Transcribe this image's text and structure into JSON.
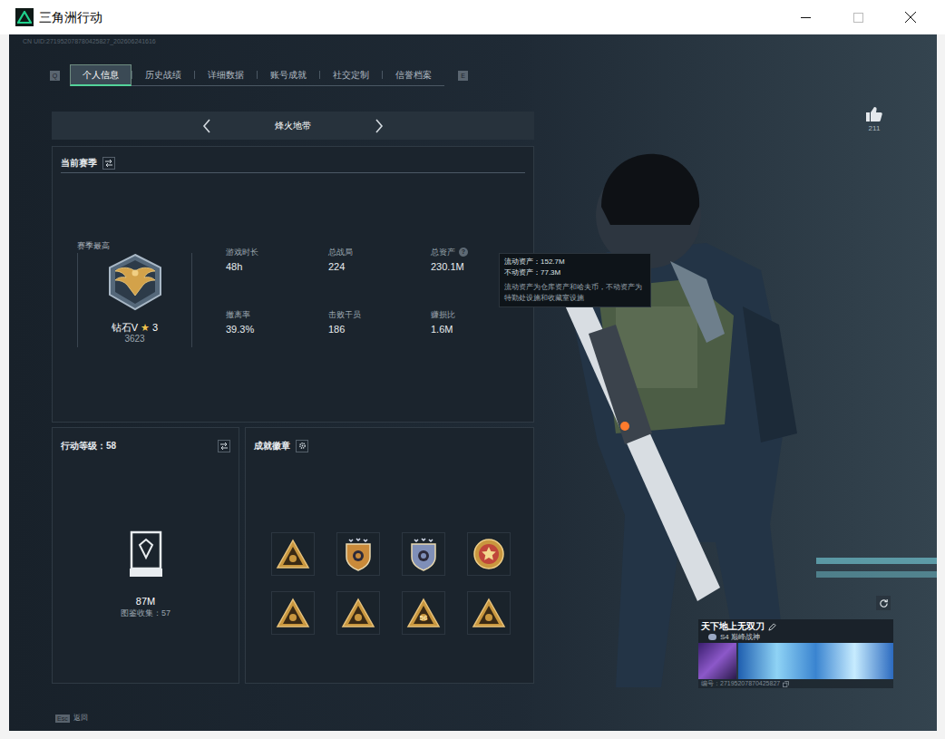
{
  "window": {
    "title": "三角洲行动"
  },
  "uid": "CN UID:271952078780425827_202606241616",
  "tabs": {
    "prev_key": "Q",
    "next_key": "E",
    "items": [
      {
        "label": "个人信息",
        "selected": true
      },
      {
        "label": "历史战绩",
        "selected": false
      },
      {
        "label": "详细数据",
        "selected": false
      },
      {
        "label": "账号成就",
        "selected": false
      },
      {
        "label": "社交定制",
        "selected": false
      },
      {
        "label": "信誉档案",
        "selected": false
      }
    ]
  },
  "mode": {
    "label": "烽火地带"
  },
  "season": {
    "title": "当前赛季",
    "best_label": "赛季最高",
    "rank": "钻石V",
    "rank_star": "★",
    "rank_stars": "3",
    "score": "3623",
    "stats": [
      {
        "label": "游戏时长",
        "value": "48h",
        "help": ""
      },
      {
        "label": "总战局",
        "value": "224",
        "help": ""
      },
      {
        "label": "总资产",
        "value": "230.1M",
        "help": "?"
      },
      {
        "label": "撤离率",
        "value": "39.3%",
        "help": ""
      },
      {
        "label": "击败干员",
        "value": "186",
        "help": ""
      },
      {
        "label": "赚损比",
        "value": "1.6M",
        "help": ""
      }
    ]
  },
  "tooltip": {
    "lines": [
      "流动资产：152.7M",
      "不动资产：77.3M"
    ],
    "note": "流动资产为仓库资产和哈夫币，不动资产为特勤处设施和收藏室设施"
  },
  "level_panel": {
    "title": "行动等级：58",
    "value": "87M",
    "collection": "图鉴收集：57"
  },
  "badges": {
    "title": "成就徽章",
    "items": [
      {
        "kind": "triangle",
        "color": "#c9973f",
        "label": ""
      },
      {
        "kind": "shield",
        "color": "#c98a3a",
        "label": ""
      },
      {
        "kind": "shield",
        "color": "#7f8fb8",
        "label": ""
      },
      {
        "kind": "medal",
        "color": "#c0463a",
        "label": ""
      },
      {
        "kind": "triangle",
        "color": "#c9973f",
        "label": ""
      },
      {
        "kind": "triangle",
        "color": "#c9973f",
        "label": ""
      },
      {
        "kind": "triangle",
        "color": "#c9973f",
        "label": "56"
      },
      {
        "kind": "triangle",
        "color": "#c9973f",
        "label": ""
      }
    ]
  },
  "likes": "211",
  "profile": {
    "name": "天下地上无双刀",
    "title": "S4 巅峰战神",
    "id": "编号：27195207870425827"
  },
  "footer": {
    "key": "Esc",
    "label": "返回"
  }
}
